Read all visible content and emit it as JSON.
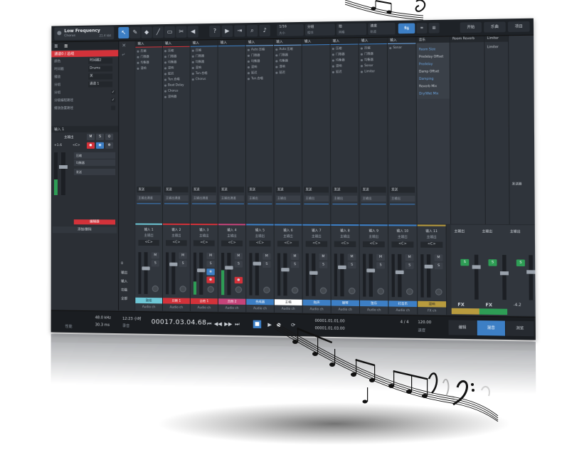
{
  "colors": {
    "accent": "#3d7fc5",
    "record_red": "#d3323a",
    "solo_green": "#2e9d55",
    "panel_dark": "#262a30"
  },
  "toolbar": {
    "song_title": "Low Frequency",
    "song_sub": "Chorus",
    "song_meta": "21.4 kbt",
    "tool_icons": [
      "pointer-icon",
      "pencil-icon",
      "eraser-icon",
      "paint-icon",
      "range-icon",
      "split-icon",
      "speaker-icon"
    ],
    "tool_glyphs": [
      "↖",
      "✎",
      "◆",
      "╱",
      "▭",
      "✂",
      "◀"
    ],
    "help_glyph": "?",
    "quant_label": "1/16",
    "quant_sub": "大小",
    "snap_label": "分组",
    "snap_sub": "相邻",
    "timebase_label": "拍",
    "timebase_sub": "网格",
    "vol_label": "速度",
    "vol_sub": "轨道",
    "loop_glyph": "⇆",
    "mode_buttons": [
      "开始",
      "乐曲",
      "项目"
    ]
  },
  "inspector": {
    "tabs": [
      "面",
      "面"
    ],
    "title": "通道0 / 总线",
    "rows": [
      {
        "k": "颜色",
        "v": "时间戳2"
      },
      {
        "k": "时间戳",
        "v": "Drums"
      },
      {
        "k": "播放",
        "v": "关"
      },
      {
        "k": "分组",
        "v": "通道 1"
      }
    ],
    "checks": [
      {
        "k": "分组",
        "v": "✓"
      },
      {
        "k": "分级编程路径",
        "v": "✓"
      },
      {
        "k": "播放放置路径",
        "v": ""
      }
    ],
    "section_input": "输入 1",
    "bus_label": "主输出",
    "gain": "<C>",
    "level": "+1.6",
    "inserts": [
      "压缩",
      "均衡器"
    ],
    "send_label": "发送",
    "rec_bar": "编辑器",
    "bottom_bar": "添加/删除"
  },
  "leftcol": {
    "labels": [
      "0",
      "输出",
      "输入",
      "功能",
      "全部"
    ]
  },
  "racks": [
    {
      "header": "输入",
      "slots": [
        "压缩",
        "门限器",
        "均衡器",
        "混响"
      ]
    },
    {
      "header": "输入",
      "slots": [
        "压缩",
        "门限器",
        "均衡器",
        "混响",
        "延迟",
        "Tun.合唱",
        "Beat Delay",
        "Chorus",
        "混响器"
      ]
    },
    {
      "header": "输入",
      "slots": [
        "压缩",
        "门限器",
        "均衡器",
        "混响",
        "Tun.合唱",
        "Chorus"
      ]
    },
    {
      "header": "输入",
      "slots": []
    },
    {
      "header": "输入",
      "slots": [
        "Auto 压缩",
        "门限器",
        "均衡器",
        "混响",
        "延迟",
        "Tun.合唱"
      ]
    },
    {
      "header": "输入",
      "slots": [
        "Auto 压缩",
        "门限器",
        "均衡器",
        "混响",
        "延迟"
      ]
    },
    {
      "header": "输入",
      "slots": []
    },
    {
      "header": "输入",
      "slots": [
        "压缩",
        "门限器",
        "均衡器",
        "混响",
        "延迟"
      ]
    },
    {
      "header": "输入",
      "slots": [
        "压缩",
        "门限器",
        "均衡器",
        "Sonar",
        "Limiter"
      ]
    },
    {
      "header": "输入",
      "slots": [
        "Sonar"
      ]
    }
  ],
  "sends": [
    "发送",
    "发送",
    "发送",
    "发送",
    "发送",
    "发送",
    "发送",
    "发送",
    "发送",
    "发送"
  ],
  "send_subs": [
    "主输出通道",
    "主输出通道",
    "主输出通道",
    "主输出通道",
    "主输出",
    "主输出",
    "主输出",
    "主输出",
    "主输出",
    "主输出"
  ],
  "right_panels": {
    "p1_header": "音乐",
    "p1_lines": [
      "Room Size",
      "Predelay Offset",
      "Predelay",
      "Damp Offset",
      "Damping",
      "Reverb Mix",
      "Dry/Wet Mix"
    ],
    "p2_header": "Room Reverb",
    "p3_header": "Limiter",
    "p3_sub": "Limiter",
    "side_label": "发送器"
  },
  "channels": [
    {
      "in": "输入 1",
      "out": "主输出",
      "pan": "<C>",
      "name": "鼓组",
      "type": "Audio ch"
    },
    {
      "in": "输入 2",
      "out": "主输出",
      "pan": "<C>",
      "name": "贝斯 1",
      "type": "Audio ch"
    },
    {
      "in": "输入 3",
      "out": "主输出",
      "pan": "<C>",
      "name": "吉他 1",
      "type": "Audio ch"
    },
    {
      "in": "输入 4",
      "out": "主输出",
      "pan": "<C>",
      "name": "吉他 2",
      "type": "Audio ch"
    },
    {
      "in": "输入 5",
      "out": "主输出",
      "pan": "<C>",
      "name": "合成器",
      "type": "Audio ch"
    },
    {
      "in": "输入 6",
      "out": "主输出",
      "pan": "<C>",
      "name": "主唱",
      "type": "Audio ch"
    },
    {
      "in": "输入 7",
      "out": "主输出",
      "pan": "<C>",
      "name": "和声",
      "type": "Audio ch"
    },
    {
      "in": "输入 8",
      "out": "主输出",
      "pan": "<C>",
      "name": "钢琴",
      "type": "Audio ch"
    },
    {
      "in": "输入 9",
      "out": "主输出",
      "pan": "<C>",
      "name": "弦乐",
      "type": "Audio ch"
    },
    {
      "in": "输入 10",
      "out": "主输出",
      "pan": "<C>",
      "name": "打击乐",
      "type": "Audio ch"
    },
    {
      "in": "输入 11",
      "out": "主输出",
      "pan": "<C>",
      "name": "混响",
      "type": "FX ch"
    }
  ],
  "outputs": {
    "main_label": "主输出",
    "fx_label": "FX",
    "master_level": "-4.2"
  },
  "transport": {
    "sample_rate": "48.0 kHz",
    "latency": "30.3 ms",
    "perf_label": "性能",
    "time_label": "12:23 小时",
    "time_sub": "录音",
    "timecode": "00017.03.04.68",
    "loc_l": "00001.01.01.00",
    "loc_r": "00001.01.03.00",
    "signature": "4 / 4",
    "tempo": "120.00",
    "tempo_label": "速度",
    "tabs": [
      "编辑",
      "混音",
      "浏览"
    ]
  }
}
